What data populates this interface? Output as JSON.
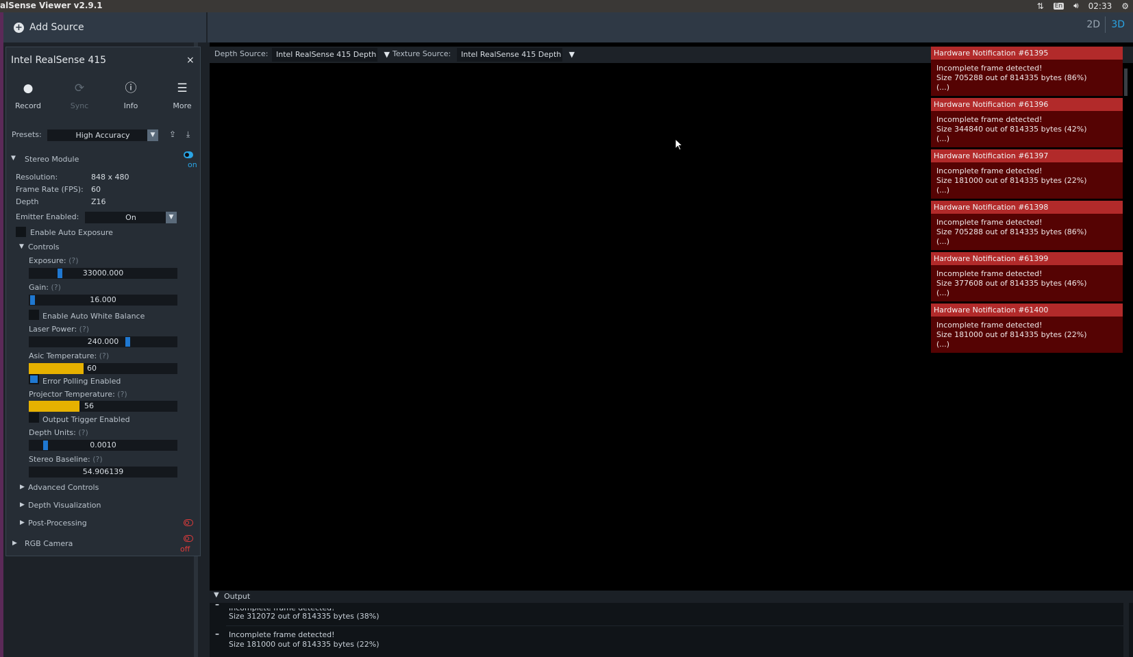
{
  "system_bar": {
    "title": "alSense Viewer v2.9.1",
    "lang": "En",
    "time": "02:33"
  },
  "toolbar": {
    "add_source": "Add Source",
    "view_2d": "2D",
    "view_3d": "3D"
  },
  "device": {
    "name": "Intel RealSense 415",
    "close": "×",
    "tools": [
      {
        "label": "Record",
        "icon": "record-icon"
      },
      {
        "label": "Sync",
        "icon": "sync-icon"
      },
      {
        "label": "Info",
        "icon": "info-icon"
      },
      {
        "label": "More",
        "icon": "menu-icon"
      }
    ],
    "presets_label": "Presets:",
    "preset_value": "High Accuracy",
    "stereo_module": "Stereo Module",
    "stereo_state": "on",
    "resolution_label": "Resolution:",
    "resolution_value": "848 x 480",
    "fps_label": "Frame Rate (FPS):",
    "fps_value": "60",
    "depth_label": "Depth",
    "depth_value": "Z16",
    "emitter_label": "Emitter Enabled:",
    "emitter_value": "On",
    "auto_exposure_label": "Enable Auto Exposure",
    "controls_label": "Controls",
    "help": "(?)",
    "exposure_label": "Exposure:",
    "exposure_value": "33000.000",
    "exposure_level": 0.2,
    "gain_label": "Gain:",
    "gain_value": "16.000",
    "gain_level": 0.01,
    "awb_label": "Enable Auto White Balance",
    "laser_label": "Laser Power:",
    "laser_value": "240.000",
    "laser_level": 0.67,
    "asic_label": "Asic Temperature:",
    "asic_value": "60",
    "asic_level": 0.37,
    "error_polling_label": "Error Polling Enabled",
    "projector_label": "Projector Temperature:",
    "projector_value": "56",
    "projector_level": 0.34,
    "output_trigger_label": "Output Trigger Enabled",
    "depth_units_label": "Depth Units:",
    "depth_units_value": "0.0010",
    "depth_units_level": 0.1,
    "baseline_label": "Stereo Baseline:",
    "baseline_value": "54.906139",
    "advanced_controls": "Advanced Controls",
    "depth_visualization": "Depth Visualization",
    "post_processing": "Post-Processing",
    "rgb_camera": "RGB Camera",
    "rgb_state": "off"
  },
  "viewport": {
    "depth_source_label": "Depth Source:",
    "depth_source_value": "Intel RealSense 415 Depth",
    "texture_source_label": "Texture Source:",
    "texture_source_value": "Intel RealSense 415 Depth"
  },
  "notifications": [
    {
      "title": "Hardware Notification #61395",
      "line1": "Incomplete frame detected!",
      "line2": "Size 705288 out of 814335 bytes (86%)",
      "more": "(...)"
    },
    {
      "title": "Hardware Notification #61396",
      "line1": "Incomplete frame detected!",
      "line2": "Size 344840 out of 814335 bytes (42%)",
      "more": "(...)"
    },
    {
      "title": "Hardware Notification #61397",
      "line1": "Incomplete frame detected!",
      "line2": "Size 181000 out of 814335 bytes (22%)",
      "more": "(...)"
    },
    {
      "title": "Hardware Notification #61398",
      "line1": "Incomplete frame detected!",
      "line2": "Size 705288 out of 814335 bytes (86%)",
      "more": "(...)"
    },
    {
      "title": "Hardware Notification #61399",
      "line1": "Incomplete frame detected!",
      "line2": "Size 377608 out of 814335 bytes (46%)",
      "more": "(...)"
    },
    {
      "title": "Hardware Notification #61400",
      "line1": "Incomplete frame detected!",
      "line2": "Size 181000 out of 814335 bytes (22%)",
      "more": "(...)"
    }
  ],
  "output": {
    "title": "Output",
    "entries": [
      {
        "line1": "Incomplete frame detected!",
        "line2": "Size 312072 out of 814335 bytes (38%)"
      },
      {
        "line1": "Incomplete frame detected!",
        "line2": "Size 181000 out of 814335 bytes (22%)"
      }
    ]
  },
  "colors": {
    "accent": "#2aa4e4",
    "slider_thumb": "#1f78d1",
    "temperature_fill": "#e6b100",
    "notification_header": "#b22a2a",
    "notification_body": "#550303"
  }
}
